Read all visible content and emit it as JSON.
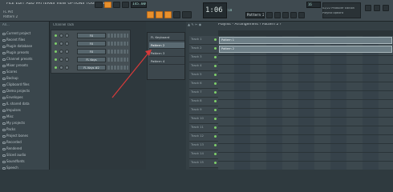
{
  "menu": {
    "items": [
      "FILE",
      "EDIT",
      "ADD",
      "PATTERNS",
      "VIEW",
      "OPTIONS",
      "TOOLS",
      "HELP"
    ]
  },
  "project": {
    "name": "FL Pkt",
    "pattern": "Pattern 2"
  },
  "transport": {
    "tempo": "145.000",
    "time": "1:06",
    "time_sub": ":18",
    "pattern_selector": "Pattern 2",
    "cpu": "16"
  },
  "hint": {
    "line1": "02/22  Producer Edition",
    "line2": "Playlist options"
  },
  "browser": {
    "header": "All...",
    "items": [
      {
        "icon": "folder",
        "label": "Current project"
      },
      {
        "icon": "folder",
        "label": "Recent files"
      },
      {
        "icon": "plug",
        "label": "Plugin database"
      },
      {
        "icon": "plug",
        "label": "Plugin presets"
      },
      {
        "icon": "folder",
        "label": "Channel presets"
      },
      {
        "icon": "folder",
        "label": "Mixer presets"
      },
      {
        "icon": "folder",
        "label": "Scores"
      },
      {
        "icon": "folder",
        "label": "Backup"
      },
      {
        "icon": "folder",
        "label": "Clipboard files"
      },
      {
        "icon": "folder",
        "label": "Demo projects"
      },
      {
        "icon": "folder",
        "label": "Envelopes"
      },
      {
        "icon": "folder",
        "label": "IL shared data"
      },
      {
        "icon": "folder",
        "label": "Impulses"
      },
      {
        "icon": "folder",
        "label": "Misc"
      },
      {
        "icon": "folder",
        "label": "My projects"
      },
      {
        "icon": "folder",
        "label": "Packs"
      },
      {
        "icon": "folder",
        "label": "Project bones"
      },
      {
        "icon": "folder",
        "label": "Recorded"
      },
      {
        "icon": "folder",
        "label": "Rendered"
      },
      {
        "icon": "folder",
        "label": "Sliced audio"
      },
      {
        "icon": "folder",
        "label": "Soundfonts"
      },
      {
        "icon": "folder",
        "label": "Speech"
      }
    ]
  },
  "channel_rack": {
    "title": "Channel rack",
    "channels": [
      {
        "name": "FX"
      },
      {
        "name": "FX"
      },
      {
        "name": "FX"
      },
      {
        "name": "FL Keys"
      },
      {
        "name": "FL Keys #2"
      }
    ]
  },
  "pattern_picker": {
    "items": [
      "FL Keyboard",
      "Pattern 2",
      "Pattern 3",
      "Pattern 4"
    ],
    "selected_index": 1
  },
  "playlist": {
    "title": "Playlist - Arrangement › Pattern 2 ›",
    "tracks": [
      "Track 1",
      "Track 2",
      "Track 3",
      "Track 4",
      "Track 5",
      "Track 6",
      "Track 7",
      "Track 8",
      "Track 9",
      "Track 10",
      "Track 11",
      "Track 12",
      "Track 13",
      "Track 14",
      "Track 15"
    ],
    "clips": [
      {
        "track": 1,
        "label": "Pattern 1"
      },
      {
        "track": 2,
        "label": "Pattern 2"
      }
    ]
  },
  "colors": {
    "accent": "#e8902c",
    "annotation_arrow": "#d83a3a"
  }
}
